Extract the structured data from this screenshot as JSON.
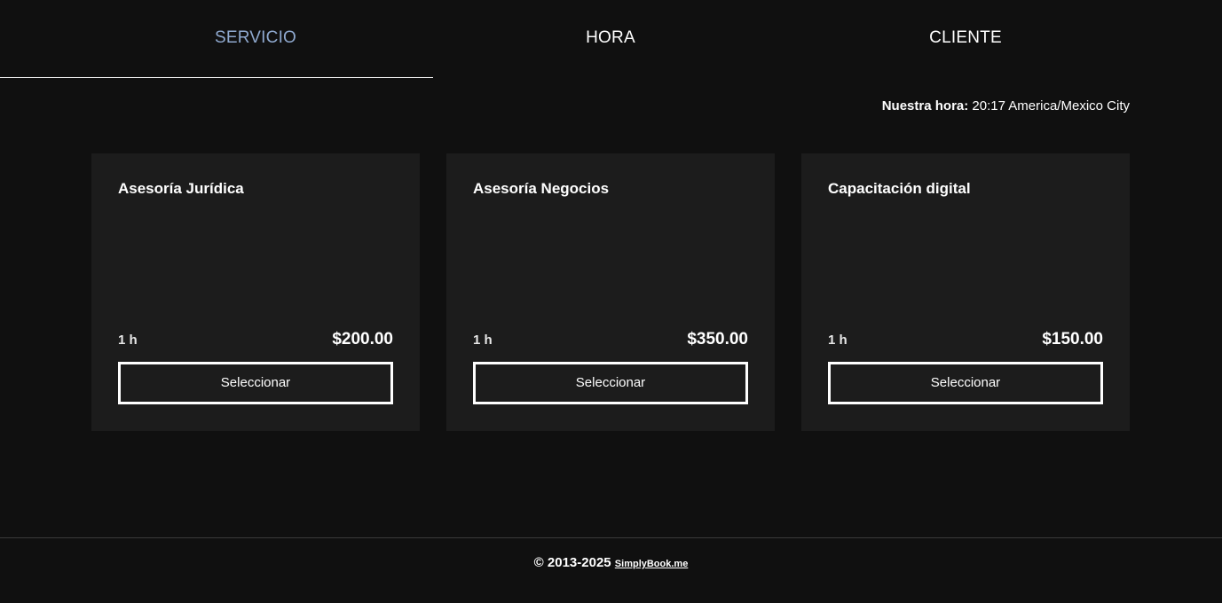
{
  "tabs": [
    {
      "label": "SERVICIO"
    },
    {
      "label": "HORA"
    },
    {
      "label": "CLIENTE"
    }
  ],
  "time_info": {
    "label": "Nuestra hora:",
    "value": "20:17 America/Mexico City"
  },
  "services": [
    {
      "name": "Asesoría Jurídica",
      "duration": "1 h",
      "price": "$200.00",
      "button": "Seleccionar"
    },
    {
      "name": "Asesoría Negocios",
      "duration": "1 h",
      "price": "$350.00",
      "button": "Seleccionar"
    },
    {
      "name": "Capacitación digital",
      "duration": "1 h",
      "price": "$150.00",
      "button": "Seleccionar"
    }
  ],
  "footer": {
    "copyright": "© 2013-2025",
    "link_text": "SimplyBook.me"
  },
  "colors": {
    "background": "#101010",
    "card_background": "#1c1c1c",
    "active_tab": "#8fa9cf",
    "text": "#ffffff"
  }
}
